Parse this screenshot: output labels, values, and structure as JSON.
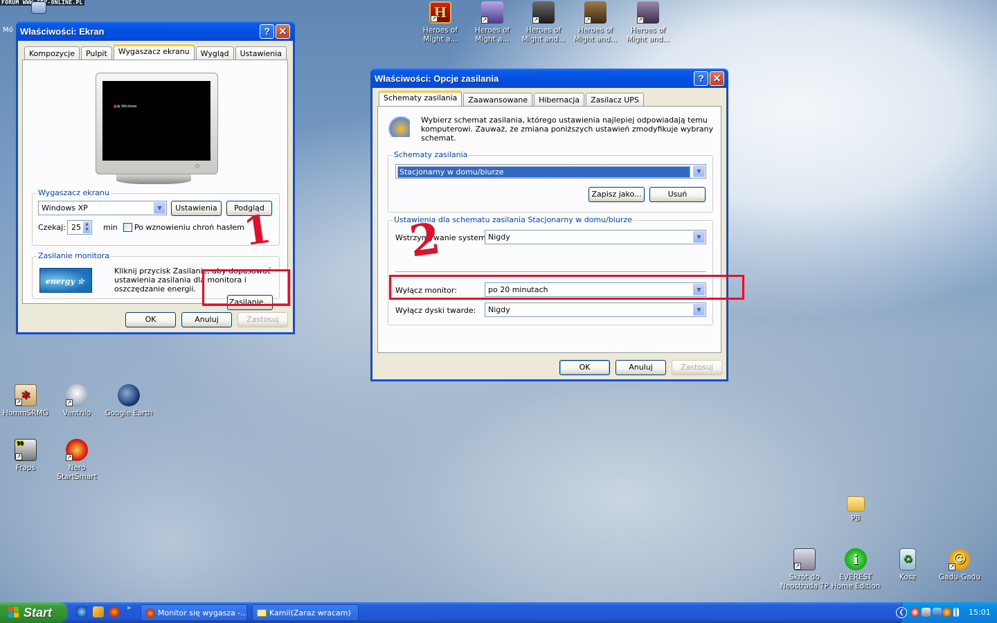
{
  "watermark": "FORUM WWW.GRY-ONLINE.PL",
  "desktop_icons": {
    "top": [
      "Heroes of\nMight a...",
      "Heroes of\nMight a...",
      "Heroes of\nMight and...",
      "Heroes of\nMight and...",
      "Heroes of\nMight and..."
    ],
    "homm": "HommSRMG",
    "ventrilo": "Ventrilo",
    "gearth": "Google Earth",
    "fraps": "Fraps",
    "nero": "Nero\nStartSmart",
    "pb": "PB",
    "skrot": "Skrót do\nNeostrada TP",
    "everest": "EVEREST\nHome Edition",
    "kosz": "Kosz",
    "gadu": "Gadu-Gadu",
    "moj": "Mó"
  },
  "display_window": {
    "title": "Właściwości: Ekran",
    "tabs": [
      "Kompozycje",
      "Pulpit",
      "Wygaszacz ekranu",
      "Wygląd",
      "Ustawienia"
    ],
    "preview_logo": "Windows",
    "screensaver_group": "Wygaszacz ekranu",
    "screensaver_value": "Windows XP",
    "settings_btn": "Ustawienia",
    "preview_btn": "Podgląd",
    "wait_label": "Czekaj:",
    "wait_value": "25",
    "min_label": "min",
    "password_label": "Po wznowieniu chroń hasłem",
    "power_group": "Zasilanie monitora",
    "power_text": "Kliknij przycisk Zasilanie, aby dopasować ustawienia zasilania dla monitora i oszczędzanie energii.",
    "energy_logo": "energy",
    "power_btn": "Zasilanie...",
    "ok": "OK",
    "cancel": "Anuluj",
    "apply": "Zastosuj"
  },
  "power_window": {
    "title": "Właściwości: Opcje zasilania",
    "tabs": [
      "Schematy zasilania",
      "Zaawansowane",
      "Hibernacja",
      "Zasilacz UPS"
    ],
    "intro": "Wybierz schemat zasilania, którego ustawienia najlepiej odpowiadają temu komputerowi. Zauważ, że zmiana poniższych ustawień zmodyfikuje wybrany schemat.",
    "schemes_group": "Schematy zasilania",
    "scheme_value": "Stacjonarny w domu/biurze",
    "save_as": "Zapisz jako...",
    "delete": "Usuń",
    "settings_group": "Ustawienia dla schematu zasilania Stacjonarny w domu/biurze",
    "standby_label": "Wstrzymywanie systemu:",
    "standby_value": "Nigdy",
    "monitor_label": "Wyłącz monitor:",
    "monitor_value": "po 20 minutach",
    "disks_label": "Wyłącz dyski twarde:",
    "disks_value": "Nigdy",
    "ok": "OK",
    "cancel": "Anuluj",
    "apply": "Zastosuj"
  },
  "annotations": {
    "one": "1",
    "two": "2"
  },
  "taskbar": {
    "start": "Start",
    "task1": "Monitor się wygasza -...",
    "task2": "Kamil(Zaraz wracam)",
    "clock": "15:01",
    "expand": "»"
  },
  "colors": {
    "accent": "#0a5bea",
    "highlight": "#316ac5",
    "annotation": "#e0102a"
  }
}
